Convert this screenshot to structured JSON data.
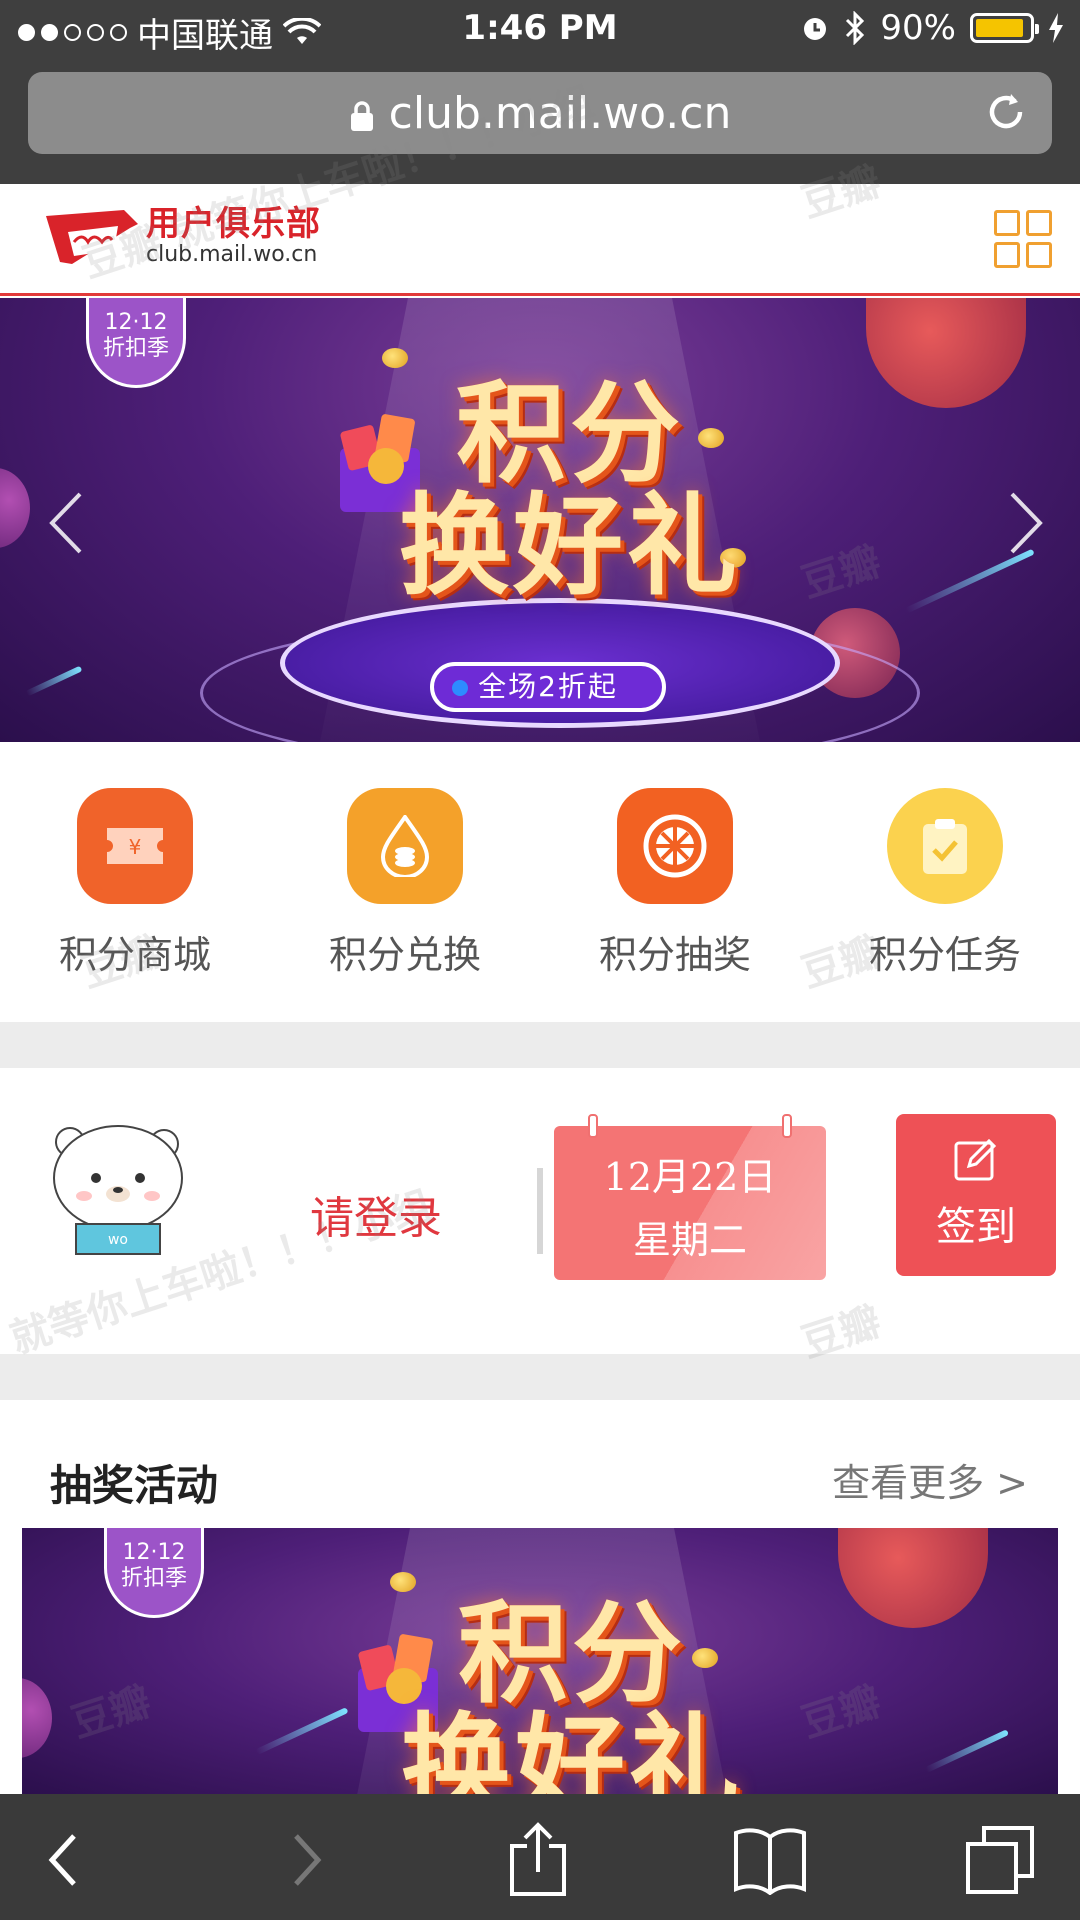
{
  "status_bar": {
    "carrier": "中国联通",
    "time": "1:46 PM",
    "battery": "90%"
  },
  "browser": {
    "url": "club.mail.wo.cn"
  },
  "site": {
    "logo_cn": "用户俱乐部",
    "logo_en": "club.mail.wo.cn"
  },
  "banner": {
    "badge_line1": "12·12",
    "badge_line2": "折扣季",
    "title_line1": "积分",
    "title_line2": "换好礼",
    "pill": "全场2折起"
  },
  "shortcuts": [
    {
      "label": "积分商城",
      "icon": "ticket-icon",
      "color": "#f0632a"
    },
    {
      "label": "积分兑换",
      "icon": "coins-drop-icon",
      "color": "#f4a12a"
    },
    {
      "label": "积分抽奖",
      "icon": "wheel-icon",
      "color": "#f26122"
    },
    {
      "label": "积分任务",
      "icon": "clipboard-check-icon",
      "color": "#fbd24e"
    }
  ],
  "checkin": {
    "login_text": "请登录",
    "date": "12月22日",
    "weekday": "星期二",
    "signin_label": "签到"
  },
  "lottery": {
    "title": "抽奖活动",
    "more": "查看更多 >"
  },
  "watermark": {
    "brand": "豆瓣",
    "phrase": "就等你上车啦！！！小组"
  },
  "colors": {
    "brand_red": "#e0383f",
    "accent_orange": "#f0a030",
    "status_bar": "#3f3f3f"
  }
}
